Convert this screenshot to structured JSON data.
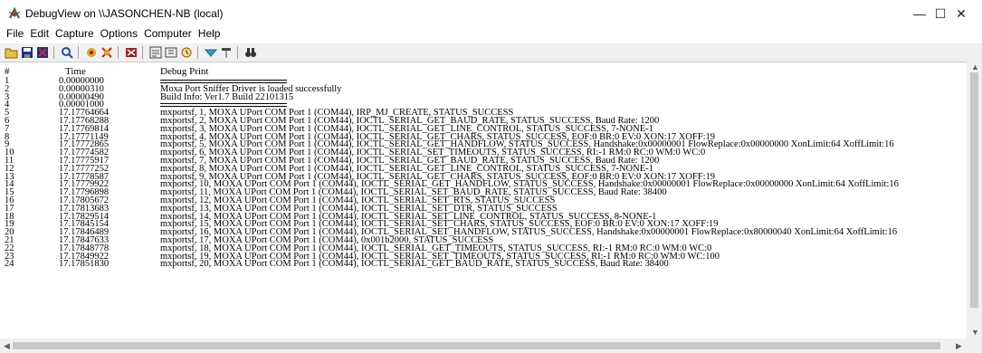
{
  "window": {
    "title": "DebugView on \\\\JASONCHEN-NB (local)",
    "minimize": "—",
    "maximize": "☐",
    "close": "✕"
  },
  "menu": [
    "File",
    "Edit",
    "Capture",
    "Options",
    "Computer",
    "Help"
  ],
  "toolbar_icons": [
    "open-icon",
    "save-icon",
    "clear-icon",
    "find-icon",
    "capture-icon",
    "autoscroll-icon",
    "filter-icon",
    "history-icon",
    "highlight-icon",
    "clock-icon",
    "properties-icon",
    "find-binoculars-icon"
  ],
  "columns": {
    "index": "#",
    "time": "Time",
    "debug_print": "Debug Print"
  },
  "rows": [
    {
      "n": "1",
      "t": "0.00000000",
      "d": "",
      "rule": true
    },
    {
      "n": "2",
      "t": "0.00000310",
      "d": "Moxa Port Sniffer Driver is loaded successfully",
      "rule": false
    },
    {
      "n": "3",
      "t": "0.00000490",
      "d": "Build Info: Ver1.7 Build 22101315",
      "rule": false
    },
    {
      "n": "4",
      "t": "0.00001000",
      "d": "",
      "rule": true
    },
    {
      "n": "5",
      "t": "17.17764664",
      "d": "mxportsf, 1, MOXA UPort COM Port 1 (COM44), IRP_MJ_CREATE, STATUS_SUCCESS",
      "rule": false
    },
    {
      "n": "6",
      "t": "17.17768288",
      "d": "mxportsf, 2, MOXA UPort COM Port 1 (COM44), IOCTL_SERIAL_GET_BAUD_RATE, STATUS_SUCCESS, Baud Rate: 1200",
      "rule": false
    },
    {
      "n": "7",
      "t": "17.17769814",
      "d": "mxportsf, 3, MOXA UPort COM Port 1 (COM44), IOCTL_SERIAL_GET_LINE_CONTROL, STATUS_SUCCESS, 7-NONE-1",
      "rule": false
    },
    {
      "n": "8",
      "t": "17.17771149",
      "d": "mxportsf, 4, MOXA UPort COM Port 1 (COM44), IOCTL_SERIAL_GET_CHARS, STATUS_SUCCESS, EOF:0 BR:0 EV:0 XON:17 XOFF:19",
      "rule": false
    },
    {
      "n": "9",
      "t": "17.17772865",
      "d": "mxportsf, 5, MOXA UPort COM Port 1 (COM44), IOCTL_SERIAL_GET_HANDFLOW, STATUS_SUCCESS, Handshake:0x00000001 FlowReplace:0x00000000 XonLimit:64 XoffLimit:16",
      "rule": false
    },
    {
      "n": "10",
      "t": "17.17774582",
      "d": "mxportsf, 6, MOXA UPort COM Port 1 (COM44), IOCTL_SERIAL_SET_TIMEOUTS, STATUS_SUCCESS, RI:-1 RM:0 RC:0 WM:0 WC:0",
      "rule": false
    },
    {
      "n": "11",
      "t": "17.17775917",
      "d": "mxportsf, 7, MOXA UPort COM Port 1 (COM44), IOCTL_SERIAL_GET_BAUD_RATE, STATUS_SUCCESS, Baud Rate: 1200",
      "rule": false
    },
    {
      "n": "12",
      "t": "17.17777252",
      "d": "mxportsf, 8, MOXA UPort COM Port 1 (COM44), IOCTL_SERIAL_GET_LINE_CONTROL, STATUS_SUCCESS, 7-NONE-1",
      "rule": false
    },
    {
      "n": "13",
      "t": "17.17778587",
      "d": "mxportsf, 9, MOXA UPort COM Port 1 (COM44), IOCTL_SERIAL_GET_CHARS, STATUS_SUCCESS, EOF:0 BR:0 EV:0 XON:17 XOFF:19",
      "rule": false
    },
    {
      "n": "14",
      "t": "17.17779922",
      "d": "mxportsf, 10, MOXA UPort COM Port 1 (COM44), IOCTL_SERIAL_GET_HANDFLOW, STATUS_SUCCESS, Handshake:0x00000001 FlowReplace:0x00000000 XonLimit:64 XoffLimit:16",
      "rule": false
    },
    {
      "n": "15",
      "t": "17.17796898",
      "d": "mxportsf, 11, MOXA UPort COM Port 1 (COM44), IOCTL_SERIAL_SET_BAUD_RATE, STATUS_SUCCESS, Baud Rate: 38400",
      "rule": false
    },
    {
      "n": "16",
      "t": "17.17805672",
      "d": "mxportsf, 12, MOXA UPort COM Port 1 (COM44), IOCTL_SERIAL_SET_RTS, STATUS_SUCCESS",
      "rule": false
    },
    {
      "n": "17",
      "t": "17.17813683",
      "d": "mxportsf, 13, MOXA UPort COM Port 1 (COM44), IOCTL_SERIAL_SET_DTR, STATUS_SUCCESS",
      "rule": false
    },
    {
      "n": "18",
      "t": "17.17829514",
      "d": "mxportsf, 14, MOXA UPort COM Port 1 (COM44), IOCTL_SERIAL_SET_LINE_CONTROL, STATUS_SUCCESS, 8-NONE-1",
      "rule": false
    },
    {
      "n": "19",
      "t": "17.17845154",
      "d": "mxportsf, 15, MOXA UPort COM Port 1 (COM44), IOCTL_SERIAL_SET_CHARS, STATUS_SUCCESS, EOF:0 BR:0 EV:0 XON:17 XOFF:19",
      "rule": false
    },
    {
      "n": "20",
      "t": "17.17846489",
      "d": "mxportsf, 16, MOXA UPort COM Port 1 (COM44), IOCTL_SERIAL_SET_HANDFLOW, STATUS_SUCCESS, Handshake:0x00000001 FlowReplace:0x80000040 XonLimit:64 XoffLimit:16",
      "rule": false
    },
    {
      "n": "21",
      "t": "17.17847633",
      "d": "mxportsf, 17, MOXA UPort COM Port 1 (COM44), 0x001b2000, STATUS_SUCCESS",
      "rule": false
    },
    {
      "n": "22",
      "t": "17.17848778",
      "d": "mxportsf, 18, MOXA UPort COM Port 1 (COM44), IOCTL_SERIAL_GET_TIMEOUTS, STATUS_SUCCESS, RI:-1 RM:0 RC:0 WM:0 WC:0",
      "rule": false
    },
    {
      "n": "23",
      "t": "17.17849922",
      "d": "mxportsf, 19, MOXA UPort COM Port 1 (COM44), IOCTL_SERIAL_SET_TIMEOUTS, STATUS_SUCCESS, RI:-1 RM:0 RC:0 WM:0 WC:100",
      "rule": false
    },
    {
      "n": "24",
      "t": "17.17851830",
      "d": "mxportsf, 20, MOXA UPort COM Port 1 (COM44), IOCTL_SERIAL_GET_BAUD_RATE, STATUS_SUCCESS, Baud Rate: 38400",
      "rule": false
    }
  ]
}
